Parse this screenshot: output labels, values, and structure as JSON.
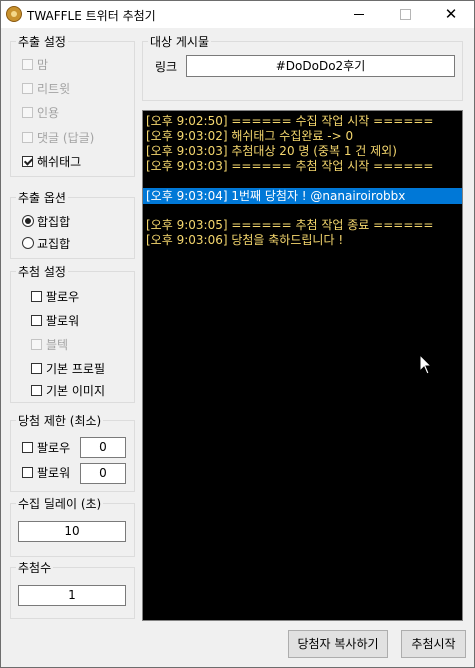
{
  "window": {
    "title": "TWAFFLE 트위터 추첨기",
    "close_glyph": "✕"
  },
  "extract_settings": {
    "legend": "추출 설정",
    "items": [
      {
        "label": "맘",
        "checked": false,
        "enabled": false
      },
      {
        "label": "리트윗",
        "checked": false,
        "enabled": false
      },
      {
        "label": "인용",
        "checked": false,
        "enabled": false
      },
      {
        "label": "댓글 (답글)",
        "checked": false,
        "enabled": false
      },
      {
        "label": "해쉬태그",
        "checked": true,
        "enabled": true
      }
    ]
  },
  "extract_options": {
    "legend": "추출 옵션",
    "options": [
      {
        "label": "합집합",
        "selected": true
      },
      {
        "label": "교집합",
        "selected": false
      }
    ]
  },
  "draw_settings": {
    "legend": "추첨 설정",
    "items": [
      {
        "label": "팔로우",
        "checked": false,
        "enabled": true
      },
      {
        "label": "팔로워",
        "checked": false,
        "enabled": true
      },
      {
        "label": "블텍",
        "checked": false,
        "enabled": false
      },
      {
        "label": "기본 프로필",
        "checked": false,
        "enabled": true
      },
      {
        "label": "기본 이미지",
        "checked": false,
        "enabled": true
      }
    ]
  },
  "win_limit": {
    "legend": "당첨 제한 (최소)",
    "follow_label": "팔로우",
    "follow_value": "0",
    "follower_label": "팔로워",
    "follower_value": "0"
  },
  "collect_delay": {
    "legend": "수집 딜레이 (초)",
    "value": "10"
  },
  "winner_count": {
    "legend": "추첨수",
    "value": "1"
  },
  "target_post": {
    "legend": "대상 게시물",
    "link_label": "링크",
    "link_value": "#DoDoDo2후기"
  },
  "log": {
    "lines": [
      "[오후 9:02:50] ====== 수집 작업 시작 ======",
      "[오후 9:03:02] 해쉬태그 수집완료 -> 0",
      "[오후 9:03:03] 추첨대상 20 명 (중복 1 건 제외)",
      "[오후 9:03:03] ====== 추첨 작업 시작 ======",
      "",
      "[오후 9:03:04] 1번째 당첨자 ! @nanairoirobbx",
      "",
      "[오후 9:03:05] ====== 추첨 작업 종료 ======",
      "[오후 9:03:06] 당첨을 축하드립니다 !"
    ],
    "selected_index": 5,
    "text_color": "#f5d76e",
    "selection_color": "#0078d7"
  },
  "buttons": {
    "copy_winners": "당첨자 복사하기",
    "start_draw": "추첨시작"
  }
}
